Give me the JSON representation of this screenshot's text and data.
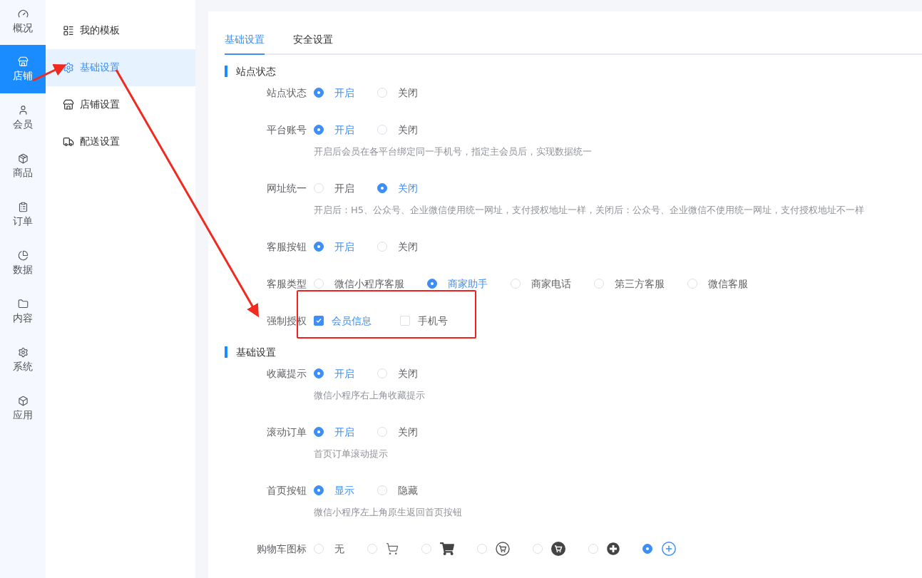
{
  "nav": [
    {
      "label": "概况",
      "selected": false
    },
    {
      "label": "店铺",
      "selected": true
    },
    {
      "label": "会员",
      "selected": false
    },
    {
      "label": "商品",
      "selected": false
    },
    {
      "label": "订单",
      "selected": false
    },
    {
      "label": "数据",
      "selected": false
    },
    {
      "label": "内容",
      "selected": false
    },
    {
      "label": "系统",
      "selected": false
    },
    {
      "label": "应用",
      "selected": false
    }
  ],
  "submenu": [
    {
      "label": "我的模板",
      "selected": false
    },
    {
      "label": "基础设置",
      "selected": true
    },
    {
      "label": "店铺设置",
      "selected": false
    },
    {
      "label": "配送设置",
      "selected": false
    }
  ],
  "tabs": [
    {
      "label": "基础设置",
      "selected": true
    },
    {
      "label": "安全设置",
      "selected": false
    }
  ],
  "sections": [
    {
      "title": "站点状态",
      "rows": [
        {
          "label": "站点状态",
          "kind": "radio",
          "options": [
            {
              "kind": "text",
              "label": "开启",
              "selected": true
            },
            {
              "kind": "text",
              "label": "关闭",
              "selected": false
            }
          ]
        },
        {
          "label": "平台账号",
          "kind": "radio",
          "options": [
            {
              "kind": "text",
              "label": "开启",
              "selected": true
            },
            {
              "kind": "text",
              "label": "关闭",
              "selected": false
            }
          ],
          "description": "开启后会员在各平台绑定同一手机号，指定主会员后，实现数据统一"
        },
        {
          "label": "网址统一",
          "kind": "radio",
          "options": [
            {
              "kind": "text",
              "label": "开启",
              "selected": false
            },
            {
              "kind": "text",
              "label": "关闭",
              "selected": true
            }
          ],
          "description": "开启后：H5、公众号、企业微信使用统一网址，支付授权地址一样，关闭后：公众号、企业微信不使用统一网址，支付授权地址不一样"
        },
        {
          "label": "客服按钮",
          "kind": "radio",
          "options": [
            {
              "kind": "text",
              "label": "开启",
              "selected": true
            },
            {
              "kind": "text",
              "label": "关闭",
              "selected": false
            }
          ]
        },
        {
          "label": "客服类型",
          "kind": "radio",
          "options": [
            {
              "kind": "text",
              "label": "微信小程序客服",
              "selected": false
            },
            {
              "kind": "text",
              "label": "商家助手",
              "selected": true
            },
            {
              "kind": "text",
              "label": "商家电话",
              "selected": false
            },
            {
              "kind": "text",
              "label": "第三方客服",
              "selected": false
            },
            {
              "kind": "text",
              "label": "微信客服",
              "selected": false
            }
          ]
        },
        {
          "label": "强制授权",
          "kind": "checkbox",
          "highlighted": true,
          "options": [
            {
              "kind": "text",
              "label": "会员信息",
              "selected": true
            },
            {
              "kind": "text",
              "label": "手机号",
              "selected": false
            }
          ]
        }
      ]
    },
    {
      "title": "基础设置",
      "rows": [
        {
          "label": "收藏提示",
          "kind": "radio",
          "options": [
            {
              "kind": "text",
              "label": "开启",
              "selected": true
            },
            {
              "kind": "text",
              "label": "关闭",
              "selected": false
            }
          ],
          "description": "微信小程序右上角收藏提示"
        },
        {
          "label": "滚动订单",
          "kind": "radio",
          "options": [
            {
              "kind": "text",
              "label": "开启",
              "selected": true
            },
            {
              "kind": "text",
              "label": "关闭",
              "selected": false
            }
          ],
          "description": "首页订单滚动提示"
        },
        {
          "label": "首页按钮",
          "kind": "radio",
          "options": [
            {
              "kind": "text",
              "label": "显示",
              "selected": true
            },
            {
              "kind": "text",
              "label": "隐藏",
              "selected": false
            }
          ],
          "description": "微信小程序左上角原生返回首页按钮"
        },
        {
          "label": "购物车图标",
          "kind": "radio",
          "options": [
            {
              "kind": "text",
              "label": "无",
              "selected": false
            },
            {
              "kind": "cartline",
              "selected": false
            },
            {
              "kind": "cartsolid",
              "selected": false
            },
            {
              "kind": "cartring",
              "selected": false
            },
            {
              "kind": "cartdisc",
              "selected": false
            },
            {
              "kind": "plusdisc",
              "selected": false
            },
            {
              "kind": "plusring",
              "selected": true
            }
          ]
        }
      ]
    }
  ]
}
